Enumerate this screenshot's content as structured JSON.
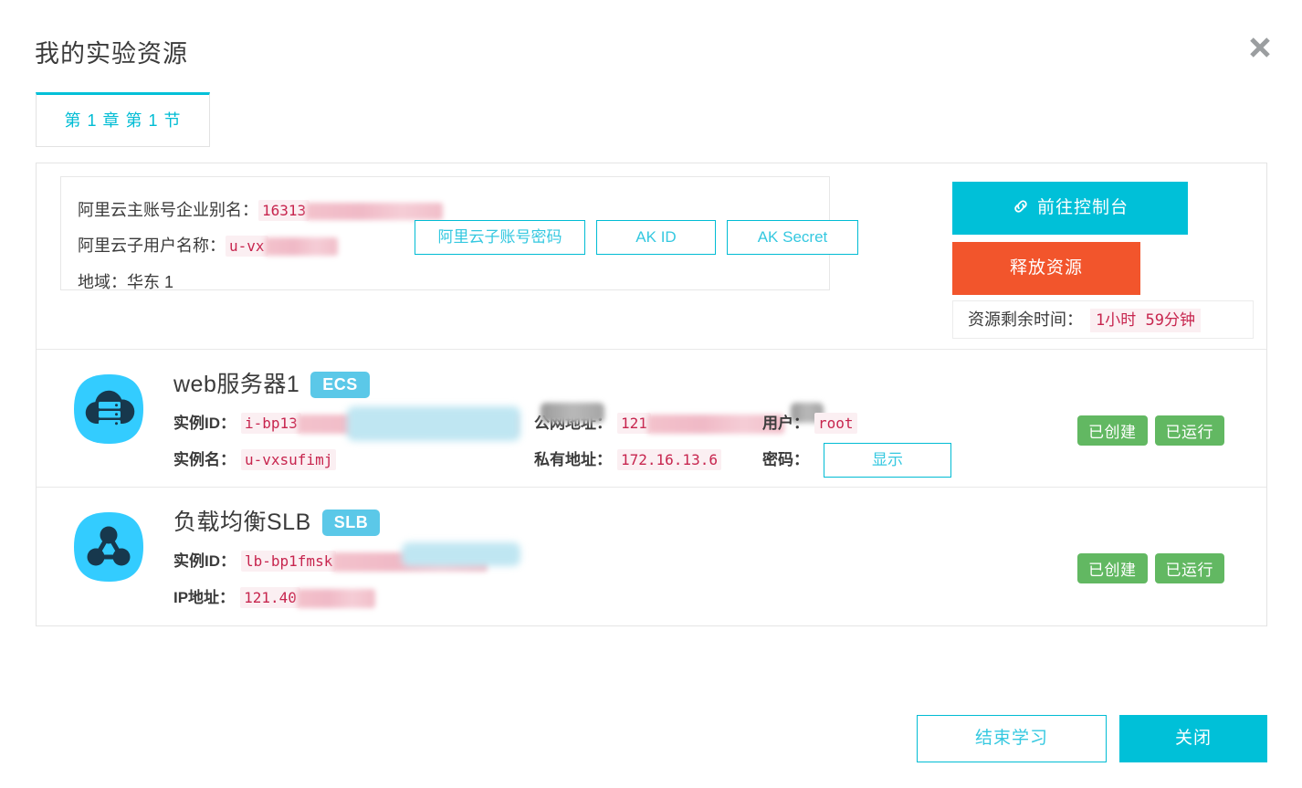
{
  "dialog": {
    "title": "我的实验资源",
    "close_icon": "close-icon"
  },
  "tabs": [
    {
      "label": "第 1 章 第 1 节",
      "active": true
    }
  ],
  "account": {
    "rows": [
      {
        "label": "阿里云主账号企业别名：",
        "value": "16313",
        "redacted": true
      },
      {
        "label": "阿里云子用户名称：",
        "value": "u-vx",
        "redacted": true
      },
      {
        "label": "地域：",
        "value": "华东 1",
        "redacted": false
      }
    ],
    "buttons": [
      {
        "label": "阿里云子账号密码",
        "name": "sub-account-password-button"
      },
      {
        "label": "AK ID",
        "name": "ak-id-button"
      },
      {
        "label": "AK Secret",
        "name": "ak-secret-button"
      }
    ]
  },
  "actions": {
    "console_label": "前往控制台",
    "console_icon": "link-icon",
    "release_label": "释放资源",
    "remaining_label": "资源剩余时间：",
    "remaining_value": "1小时  59分钟"
  },
  "resources": [
    {
      "icon": "cloud-server-icon",
      "name": "web服务器1",
      "badge": "ECS",
      "fields": [
        {
          "label": "实例ID：",
          "value": "i-bp13",
          "redacted": true
        },
        {
          "label": "实例名：",
          "value": "u-vxsufimj",
          "redacted": true
        },
        {
          "label": "公网地址：",
          "value": "121",
          "redacted": true
        },
        {
          "label": "私有地址：",
          "value": "172.16.13.6",
          "redacted": false
        },
        {
          "label": "用户：",
          "value": "root",
          "redacted": false
        },
        {
          "label": "密码：",
          "value": "显示",
          "redacted": false
        }
      ],
      "password_button_label": "显示",
      "status": [
        "已创建",
        "已运行"
      ]
    },
    {
      "icon": "slb-network-icon",
      "name": "负载均衡SLB",
      "badge": "SLB",
      "fields": [
        {
          "label": "实例ID：",
          "value": "lb-bp1fmsk",
          "redacted": true
        },
        {
          "label": "IP地址：",
          "value": "121.40",
          "redacted": true
        }
      ],
      "status": [
        "已创建",
        "已运行"
      ]
    }
  ],
  "footer": {
    "end_study_label": "结束学习",
    "close_label": "关闭"
  },
  "colors": {
    "accent_cyan": "#00c0d8",
    "danger_orange": "#f2552c",
    "status_green": "#62b862",
    "badge_blue": "#5bc8e8",
    "value_crimson": "#c7254e"
  }
}
